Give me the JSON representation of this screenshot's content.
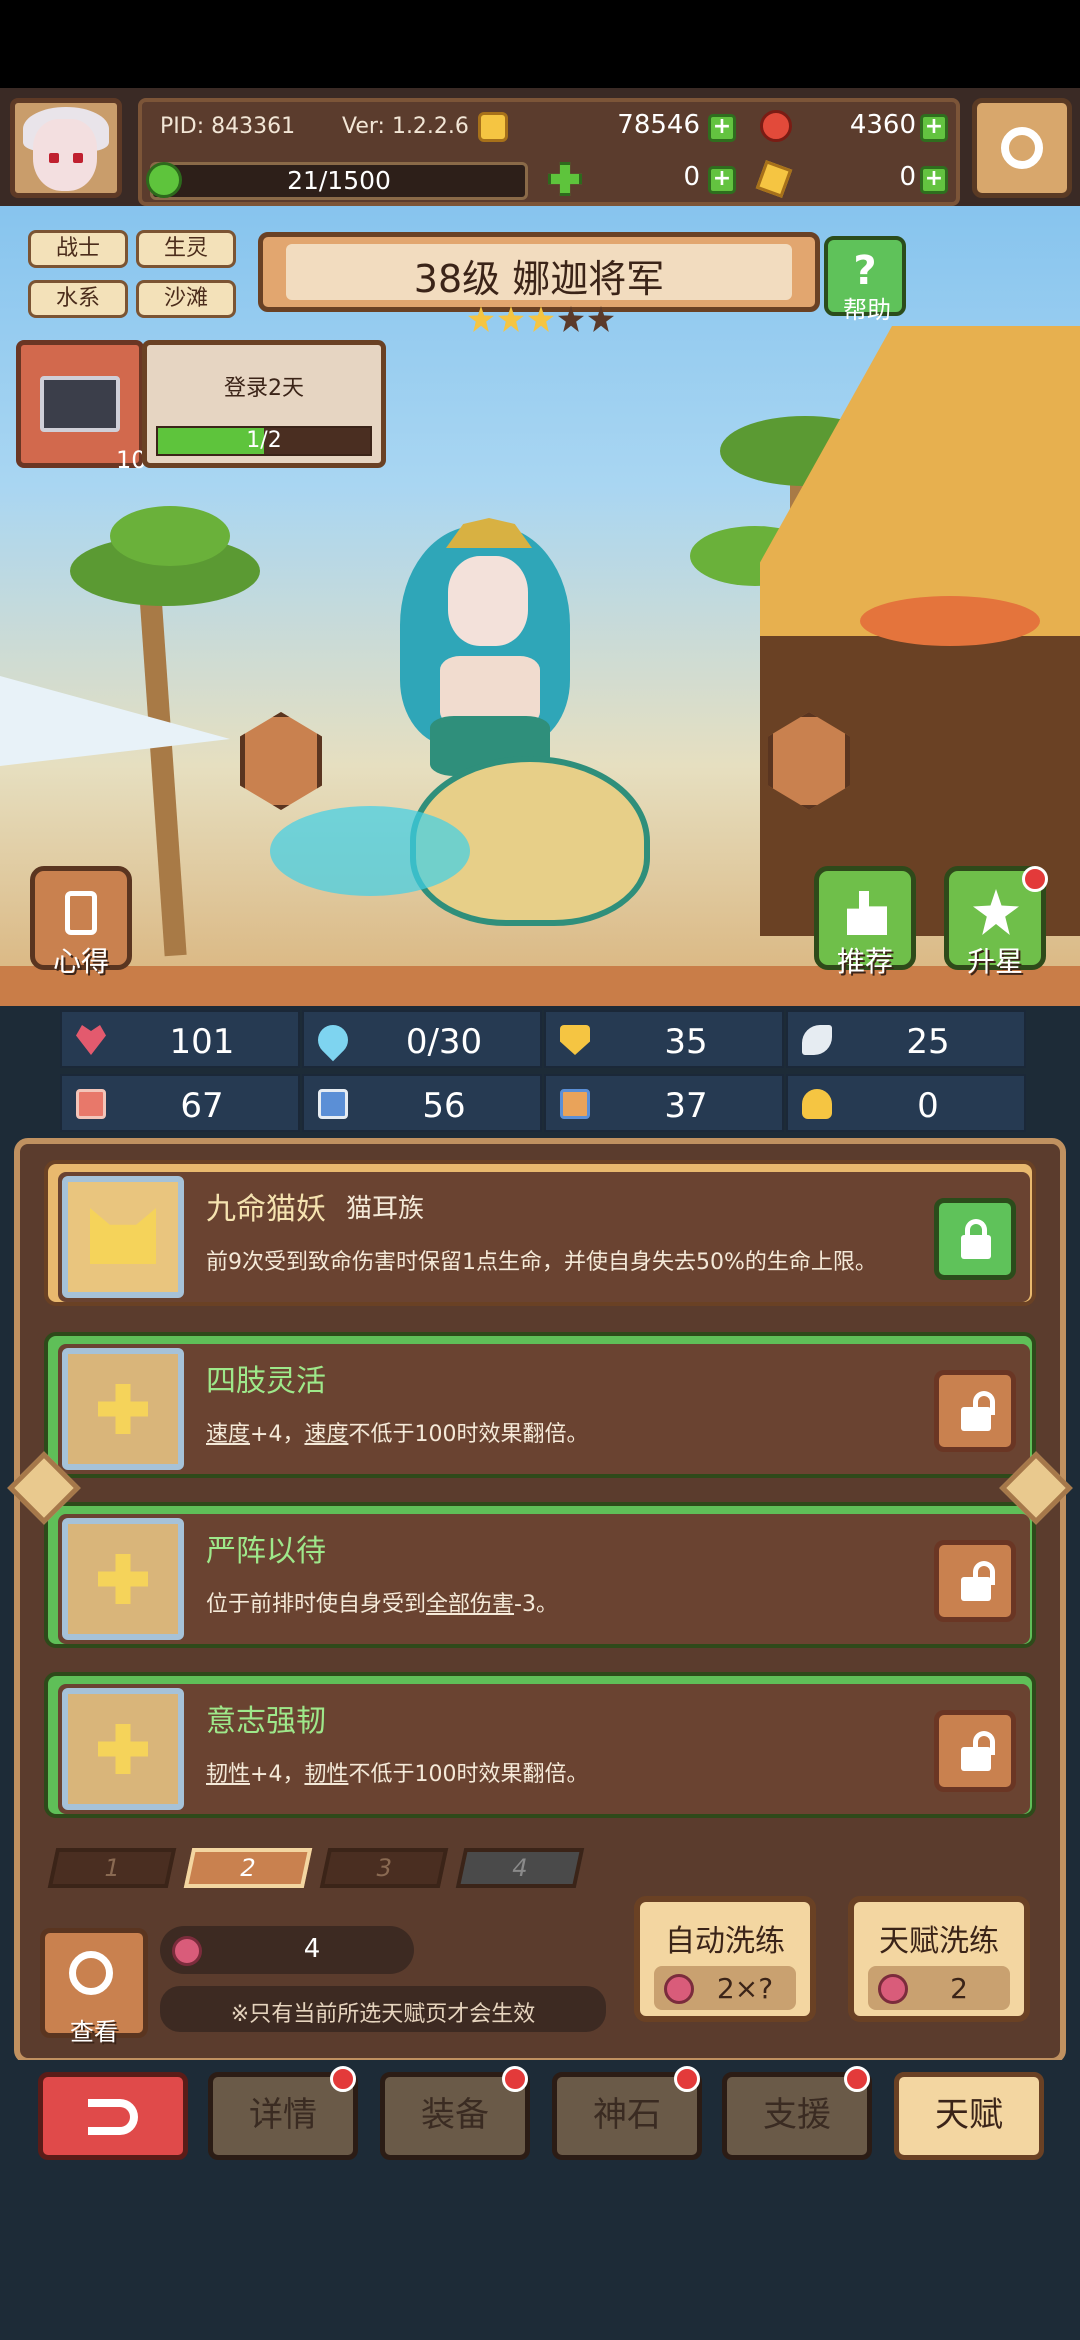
{
  "header": {
    "pid": "PID: 843361",
    "ver": "Ver: 1.2.2.6",
    "gold": "78546",
    "gems": "4360",
    "exp": "21/1500",
    "clover": "0",
    "key": "0"
  },
  "tags": [
    "战士",
    "生灵",
    "水系",
    "沙滩"
  ],
  "hero": {
    "title": "38级 娜迦将军",
    "stars_filled": 3,
    "stars_total": 5
  },
  "help_label": "帮助",
  "login": {
    "label": "登录2天",
    "progress": "1/2",
    "progress_fraction": 0.5,
    "mail_count": "10"
  },
  "scene_buttons": {
    "notes": "心得",
    "recommend": "推荐",
    "star_up": "升星"
  },
  "stats": {
    "hp": "101",
    "mana": "0/30",
    "defense": "35",
    "wing": "25",
    "attack": "67",
    "magic": "56",
    "speed": "37",
    "luck": "0"
  },
  "talents": [
    {
      "name": "九命猫妖",
      "sub": "猫耳族",
      "desc_plain": "前9次受到致命伤害时保留1点生命，并使自身失去50%的生命上限。",
      "locked": true
    },
    {
      "name": "四肢灵活",
      "desc_u1": "速度",
      "desc_a": "+4，",
      "desc_u2": "速度",
      "desc_b": "不低于100时效果翻倍。",
      "locked": false
    },
    {
      "name": "严阵以待",
      "desc_a": "位于前排时使自身受到",
      "desc_u1": "全部伤害",
      "desc_b": "-3。",
      "locked": false
    },
    {
      "name": "意志强韧",
      "desc_u1": "韧性",
      "desc_a": "+4，",
      "desc_u2": "韧性",
      "desc_b": "不低于100时效果翻倍。",
      "locked": false
    }
  ],
  "pages": [
    "1",
    "2",
    "3",
    "4"
  ],
  "talent_controls": {
    "view_label": "查看",
    "points": "4",
    "note": "※只有当前所选天赋页才会生效",
    "auto_title": "自动洗练",
    "auto_cost": "2×?",
    "talent_title": "天赋洗练",
    "talent_cost": "2"
  },
  "nav": {
    "details": "详情",
    "equip": "装备",
    "godstone": "神石",
    "support": "支援",
    "talent": "天赋"
  },
  "colors": {
    "locked_green": "#5fc25a",
    "unlocked_tan": "#c9814f",
    "accent_gold": "#f5c542",
    "selected_tab": "#f3d6a1"
  }
}
